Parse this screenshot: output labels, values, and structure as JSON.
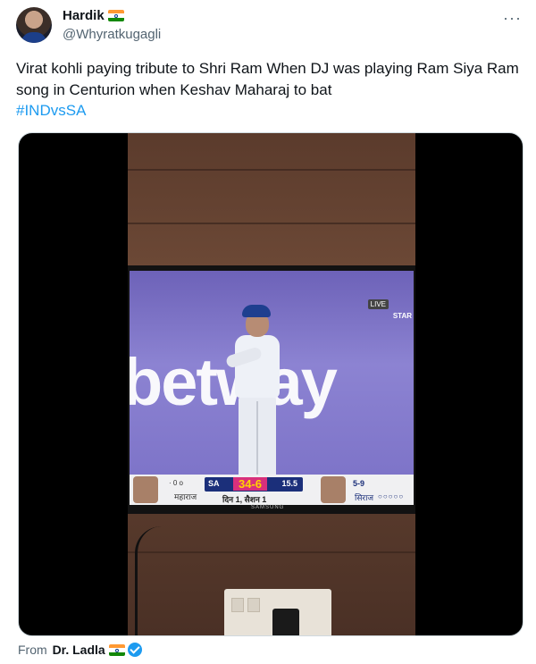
{
  "author": {
    "display_name": "Hardik",
    "handle": "@Whyratkugagli",
    "flag_icon": "india-flag-icon"
  },
  "tweet": {
    "text": "Virat kohli paying tribute to Shri Ram When DJ was playing Ram Siya Ram song in Centurion when Keshav Maharaj to bat",
    "hashtag": "#INDvsSA"
  },
  "menu": {
    "more_label": "···"
  },
  "video_overlay": {
    "board_text": "betway",
    "live_badge": "LIVE",
    "channel_text": "STAR",
    "scorebar": {
      "left_stats": "· 0 o",
      "left_name": "महाराज",
      "team": "SA",
      "score": "34-6",
      "overs": "15.5",
      "session": "दिन 1, सैशन 1",
      "bowler_figures": "5-9",
      "bowler_name": "सिराज",
      "bowler_dots": "○○○○○"
    },
    "tv_brand": "SAMSUNG"
  },
  "source": {
    "prefix": "From",
    "name": "Dr. Ladla"
  },
  "colors": {
    "link": "#1d9bf0",
    "secondary_text": "#536471",
    "primary_text": "#0f1419"
  }
}
